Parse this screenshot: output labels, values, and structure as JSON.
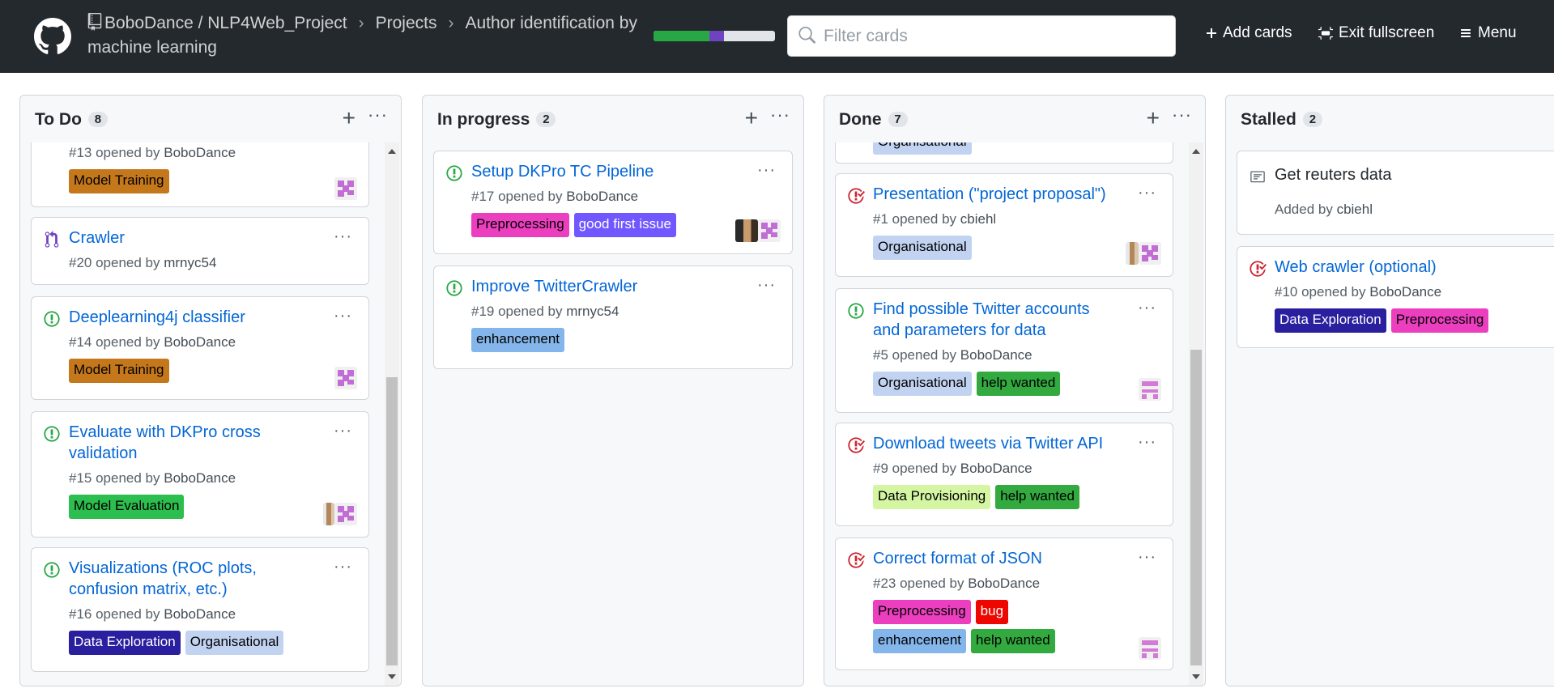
{
  "header": {
    "repo_path": "BoboDance / NLP4Web_Project",
    "projects_label": "Projects",
    "project_title": "Author identification by machine learning",
    "progress": {
      "done_fraction": 0.46,
      "in_progress_fraction": 0.12
    },
    "filter_placeholder": "Filter cards",
    "add_cards_label": "Add cards",
    "exit_fullscreen_label": "Exit fullscreen",
    "menu_label": "Menu"
  },
  "columns": {
    "todo": {
      "name": "To Do",
      "count": "8",
      "cards": [
        {
          "meta_prefix": "#13 opened by",
          "author": "BoboDance",
          "labels": [
            "Model Training"
          ]
        },
        {
          "title": "Crawler",
          "meta_prefix": "#20 opened by",
          "author": "mrnyc54"
        },
        {
          "title": "Deeplearning4j classifier",
          "meta_prefix": "#14 opened by",
          "author": "BoboDance",
          "labels": [
            "Model Training"
          ]
        },
        {
          "title_line1": "Evaluate with DKPro cross",
          "title_line2": "validation",
          "meta_prefix": "#15 opened by",
          "author": "BoboDance",
          "labels": [
            "Model Evaluation"
          ]
        },
        {
          "title_line1": "Visualizations (ROC plots,",
          "title_line2": "confusion matrix, etc.)",
          "meta_prefix": "#16 opened by",
          "author": "BoboDance",
          "labels": [
            "Data Exploration",
            "Organisational"
          ]
        }
      ]
    },
    "inprogress": {
      "name": "In progress",
      "count": "2",
      "cards": [
        {
          "title": "Setup DKPro TC Pipeline",
          "meta_prefix": "#17 opened by",
          "author": "BoboDance",
          "labels": [
            "Preprocessing",
            "good first issue"
          ]
        },
        {
          "title": "Improve TwitterCrawler",
          "meta_prefix": "#19 opened by",
          "author": "mrnyc54",
          "labels": [
            "enhancement"
          ]
        }
      ]
    },
    "done": {
      "name": "Done",
      "count": "7",
      "cards": [
        {
          "labels": [
            "Organisational"
          ]
        },
        {
          "title": "Presentation (\"project proposal\")",
          "meta_prefix": "#1 opened by",
          "author": "cbiehl",
          "labels": [
            "Organisational"
          ]
        },
        {
          "title_line1": "Find possible Twitter accounts",
          "title_line2": "and parameters for data",
          "meta_prefix": "#5 opened by",
          "author": "BoboDance",
          "labels": [
            "Organisational",
            "help wanted"
          ]
        },
        {
          "title": "Download tweets via Twitter API",
          "meta_prefix": "#9 opened by",
          "author": "BoboDance",
          "labels": [
            "Data Provisioning",
            "help wanted"
          ]
        },
        {
          "title": "Correct format of JSON",
          "meta_prefix": "#23 opened by",
          "author": "BoboDance",
          "labels": [
            "Preprocessing",
            "bug",
            "enhancement",
            "help wanted"
          ]
        }
      ]
    },
    "stalled": {
      "name": "Stalled",
      "count": "2",
      "cards": [
        {
          "note": "Get reuters data",
          "meta_prefix": "Added by",
          "author": "cbiehl"
        },
        {
          "title": "Web crawler (optional)",
          "meta_prefix": "#10 opened by",
          "author": "BoboDance",
          "labels": [
            "Data Exploration",
            "Preprocessing"
          ]
        }
      ]
    }
  },
  "label_colors": {
    "Model Training": "#c5781b",
    "Model Evaluation": "#2cbe4e",
    "Data Exploration": "#2a1f9e",
    "Organisational": "#c2d3f2",
    "Preprocessing": "#ec3fbf",
    "good first issue": "#7057ff",
    "enhancement": "#84b6eb",
    "help wanted": "#33aa3f",
    "Data Provisioning": "#d4f5a2",
    "bug": "#ee0701"
  },
  "colors": {
    "header_bg": "#24292e",
    "link": "#0366d6",
    "open_issue": "#28a745",
    "closed_issue": "#cb2431",
    "pr_icon": "#6f42c1"
  }
}
